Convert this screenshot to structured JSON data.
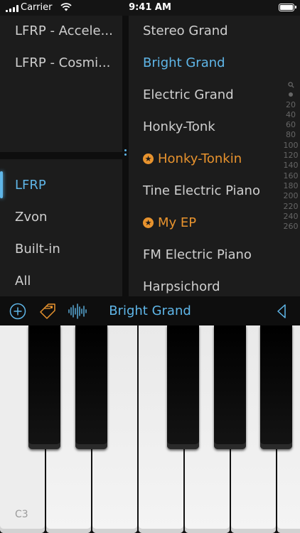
{
  "status_bar": {
    "carrier": "Carrier",
    "time": "9:41 AM"
  },
  "banks": {
    "items": [
      "LFRP - Accele...",
      "LFRP - Cosmi..."
    ]
  },
  "sources": {
    "items": [
      "LFRP",
      "Zvon",
      "Built-in",
      "All"
    ],
    "selected": "LFRP"
  },
  "presets": {
    "items": [
      {
        "label": "Stereo Grand",
        "state": "normal"
      },
      {
        "label": "Bright Grand",
        "state": "selected"
      },
      {
        "label": "Electric Grand",
        "state": "normal"
      },
      {
        "label": "Honky-Tonk",
        "state": "normal"
      },
      {
        "label": "Honky-Tonkin",
        "state": "favorite"
      },
      {
        "label": "Tine Electric Piano",
        "state": "normal"
      },
      {
        "label": "My EP",
        "state": "favorite"
      },
      {
        "label": "FM Electric Piano",
        "state": "normal"
      },
      {
        "label": "Harpsichord",
        "state": "normal"
      }
    ]
  },
  "index_bar": {
    "icons": [
      "search-icon",
      "dot-icon"
    ],
    "items": [
      "20",
      "40",
      "60",
      "80",
      "100",
      "120",
      "140",
      "160",
      "180",
      "200",
      "220",
      "240",
      "260"
    ]
  },
  "toolbar": {
    "current_preset": "Bright Grand",
    "icons": [
      "add-circle-icon",
      "tag-icon",
      "waveform-icon",
      "triangle-left-icon"
    ]
  },
  "keyboard": {
    "first_key_label": "C3"
  },
  "colors": {
    "accent": "#5fb6e8",
    "favorite": "#e8932e",
    "panel": "#1c1c1c",
    "background": "#0e0e0e"
  }
}
